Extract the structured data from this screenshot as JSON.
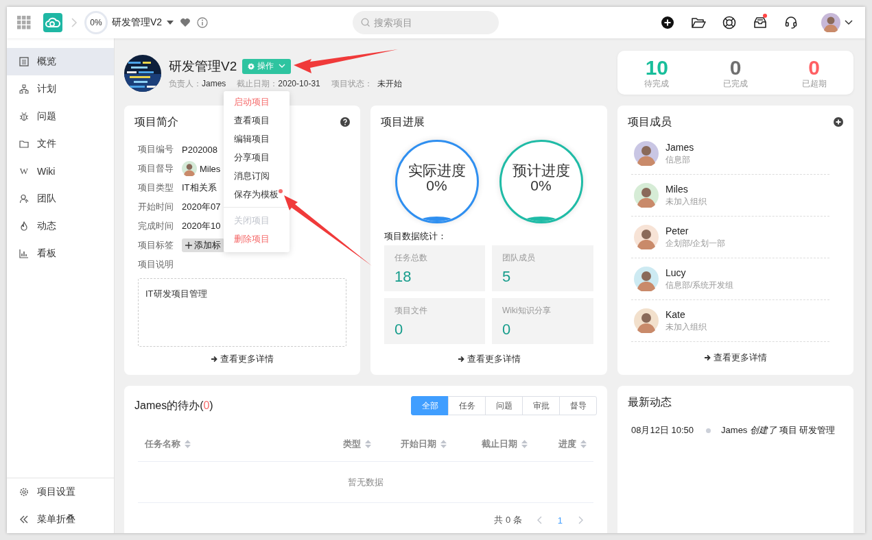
{
  "topbar": {
    "progress": "0%",
    "project": "研发管理V2",
    "search": {
      "placeholder": "搜索项目"
    },
    "icons": [
      {
        "dot": false
      },
      {
        "dot": false
      },
      {
        "dot": false
      },
      {
        "dot": true
      },
      {
        "dot": false
      }
    ]
  },
  "sidebar": {
    "items": [
      {
        "label": "概览",
        "selected": true
      },
      {
        "label": "计划",
        "selected": false
      },
      {
        "label": "问题",
        "selected": false
      },
      {
        "label": "文件",
        "selected": false
      },
      {
        "label": "Wiki",
        "glyph": "W",
        "selected": false
      },
      {
        "label": "团队",
        "selected": false
      },
      {
        "label": "动态",
        "selected": false
      },
      {
        "label": "看板",
        "selected": false
      }
    ],
    "footer": [
      {
        "label": "项目设置"
      },
      {
        "label": "菜单折叠"
      }
    ]
  },
  "header": {
    "title": "研发管理V2",
    "action": "操作",
    "meta": [
      {
        "label": "负责人：",
        "value": "James",
        "kind": "text"
      },
      {
        "label": "截止日期：",
        "value": "2020-10-31",
        "kind": "text"
      },
      {
        "label": "项目状态：",
        "value": "未开始",
        "kind": "tag"
      }
    ]
  },
  "action_menu": {
    "items": [
      {
        "kind": "item",
        "label": "启动项目",
        "danger": true,
        "disabled": false,
        "dot": false
      },
      {
        "kind": "item",
        "label": "查看项目",
        "danger": false,
        "disabled": false,
        "dot": false
      },
      {
        "kind": "item",
        "label": "编辑项目",
        "danger": false,
        "disabled": false,
        "dot": false
      },
      {
        "kind": "item",
        "label": "分享项目",
        "danger": false,
        "disabled": false,
        "dot": false
      },
      {
        "kind": "item",
        "label": "消息订阅",
        "danger": false,
        "disabled": false,
        "dot": false
      },
      {
        "kind": "item",
        "label": "保存为模板",
        "danger": false,
        "disabled": false,
        "dot": true
      },
      {
        "kind": "divider"
      },
      {
        "kind": "item",
        "label": "关闭项目",
        "danger": false,
        "disabled": true,
        "dot": false
      },
      {
        "kind": "item",
        "label": "删除项目",
        "danger": true,
        "disabled": false,
        "dot": false
      }
    ]
  },
  "summary": [
    {
      "value": "10",
      "label": "待完成",
      "color": "#19be9b"
    },
    {
      "value": "0",
      "label": "已完成",
      "color": "#707070"
    },
    {
      "value": "0",
      "label": "已超期",
      "color": "#ff5f63"
    }
  ],
  "intro": {
    "title": "项目简介",
    "fields": [
      {
        "label": "项目编号",
        "value": "P202008",
        "kind": "text"
      },
      {
        "label": "项目督导",
        "value": "Miles",
        "kind": "person"
      },
      {
        "label": "项目类型",
        "value": "IT相关系",
        "kind": "text"
      },
      {
        "label": "开始时间",
        "value": "2020年07",
        "kind": "text"
      },
      {
        "label": "完成时间",
        "value": "2020年10",
        "kind": "text"
      },
      {
        "label": "项目标签",
        "value": "添加标",
        "kind": "tag"
      }
    ],
    "description_label": "项目说明",
    "description": "IT研发项目管理",
    "more": "查看更多详情"
  },
  "progress": {
    "title": "项目进展",
    "gauges": [
      {
        "label": "实际进度",
        "value": "0%",
        "color": "#2f8ff0"
      },
      {
        "label": "预计进度",
        "value": "0%",
        "color": "#1fbba6"
      }
    ],
    "stats_title": "项目数据统计：",
    "stats": [
      {
        "label": "任务总数",
        "value": "18"
      },
      {
        "label": "团队成员",
        "value": "5"
      },
      {
        "label": "项目文件",
        "value": "0"
      },
      {
        "label": "Wiki知识分享",
        "value": "0"
      }
    ],
    "more": "查看更多详情"
  },
  "members": {
    "title": "项目成员",
    "items": [
      {
        "name": "James",
        "dept": "信息部"
      },
      {
        "name": "Miles",
        "dept": "未加入组织"
      },
      {
        "name": "Peter",
        "dept": "企划部/企划一部"
      },
      {
        "name": "Lucy",
        "dept": "信息部/系统开发组"
      },
      {
        "name": "Kate",
        "dept": "未加入组织"
      }
    ],
    "more": "查看更多详情"
  },
  "todo": {
    "title_prefix": "James的待办(",
    "count": "0",
    "title_suffix": ")",
    "filters": [
      {
        "label": "全部",
        "selected": true
      },
      {
        "label": "任务",
        "selected": false
      },
      {
        "label": "问题",
        "selected": false
      },
      {
        "label": "审批",
        "selected": false
      },
      {
        "label": "督导",
        "selected": false
      }
    ],
    "columns": [
      "任务名称",
      "类型",
      "开始日期",
      "截止日期",
      "进度"
    ],
    "empty": "暂无数据",
    "total": "共 0 条",
    "pages": [
      {
        "label": "1",
        "selected": true
      }
    ]
  },
  "activity": {
    "title": "最新动态",
    "entries": [
      {
        "time": "08月12日 10:50",
        "text": "James *创建了* 项目 研发管理"
      }
    ]
  }
}
